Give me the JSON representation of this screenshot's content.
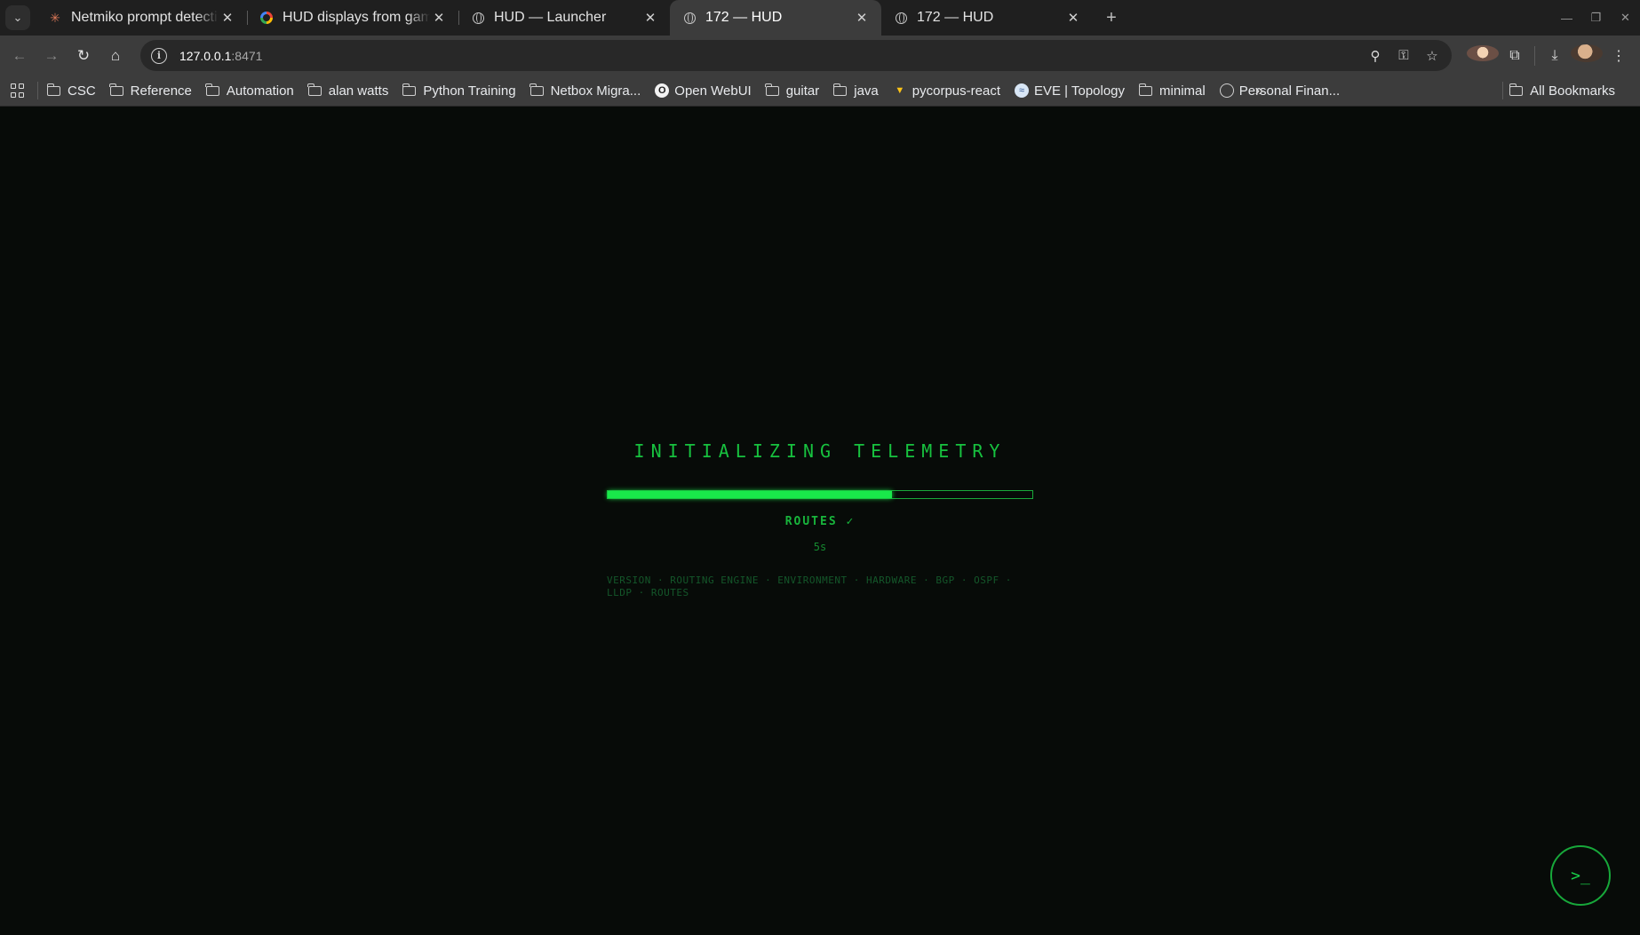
{
  "browser": {
    "tabs": [
      {
        "title": "Netmiko prompt detecti",
        "favicon": "claude-icon",
        "active": false
      },
      {
        "title": "HUD displays from game",
        "favicon": "google-icon",
        "active": false
      },
      {
        "title": "HUD — Launcher",
        "favicon": "globe-icon",
        "active": false
      },
      {
        "title": "172 — HUD",
        "favicon": "globe-icon",
        "active": true
      },
      {
        "title": "172 — HUD",
        "favicon": "globe-icon",
        "active": false
      }
    ],
    "url_host": "127.0.0.1",
    "url_port": ":8471",
    "bookmarks": [
      {
        "label": "CSC",
        "icon": "folder-icon"
      },
      {
        "label": "Reference",
        "icon": "folder-icon"
      },
      {
        "label": "Automation",
        "icon": "folder-icon"
      },
      {
        "label": "alan watts",
        "icon": "folder-icon"
      },
      {
        "label": "Python Training",
        "icon": "folder-icon"
      },
      {
        "label": "Netbox Migra...",
        "icon": "folder-icon"
      },
      {
        "label": "Open WebUI",
        "icon": "openwebui-icon"
      },
      {
        "label": "guitar",
        "icon": "folder-icon"
      },
      {
        "label": "java",
        "icon": "folder-icon"
      },
      {
        "label": "pycorpus-react",
        "icon": "vite-icon"
      },
      {
        "label": "EVE | Topology",
        "icon": "eve-icon"
      },
      {
        "label": "minimal",
        "icon": "folder-icon"
      },
      {
        "label": "Personal Finan...",
        "icon": "globe-icon"
      }
    ],
    "all_bookmarks_label": "All Bookmarks"
  },
  "loader": {
    "title": "INITIALIZING TELEMETRY",
    "progress": 0.67,
    "stage": "ROUTES ✓",
    "elapsed": "5s",
    "steps_line1": "VERSION · ROUTING ENGINE · ENVIRONMENT · HARDWARE · BGP · OSPF ·",
    "steps_line2": "LLDP · ROUTES"
  },
  "terminal_button": {
    "label": ">_"
  },
  "colors": {
    "accent": "#19e84a",
    "background": "#070b08"
  }
}
